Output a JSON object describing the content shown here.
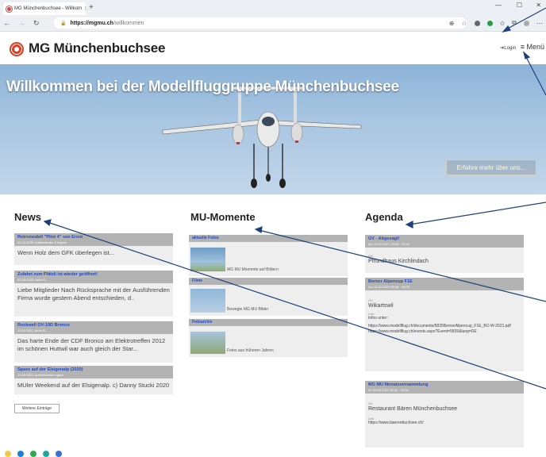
{
  "browser": {
    "tab_title": "MG Münchenbuchsee - Willkom",
    "url_domain": "https://mgmu.ch",
    "url_path": "/willkommen"
  },
  "header": {
    "site_title": "MG Münchenbuchsee",
    "login": "➔Login",
    "menu": "≡ Menü"
  },
  "hero": {
    "title": "Willkommen bei der Modellfluggruppe Münchenbuchsee",
    "button": "Erfahre mehr über uns..."
  },
  "news": {
    "title": "News",
    "items": [
      {
        "title": "Retromodell \"Pilot 4\" von Ernst",
        "meta": "02.10.2020, Administrator 0 Ingens",
        "body": "Wenn Holz dem GFK überlegen ist..."
      },
      {
        "title": "Zufahrt zum Plätzli ist wieder geöffnet!",
        "meta": "22.05.2020, Aeku B.",
        "body": " Liebe Mitglieder Nach Rücksprache mit der Ausführenden Firma wurde gestern Abend entschieden, d.."
      },
      {
        "title": "Rockwell OV-10D Bronco",
        "meta": "11.06.2020, Aeku B.",
        "body": "Das harte Ende der CDF Bronco am Elektrotreffen 2012 im schönen Huttwil war auch gleich der Star..."
      },
      {
        "title": "Spass auf der Elsigenalp (2020)",
        "meta": "11.08.2020, Administrator Ingens",
        "body": "MUler Weekend auf der Elsigenalp. c) Danny Stucki 2020"
      }
    ],
    "more": "Weitere Einträge"
  },
  "mu": {
    "title": "MU-Momente",
    "sections": [
      {
        "head": "aktuelle Fotos",
        "caption": "MG MU Momente auf Bildern"
      },
      {
        "head": "Filme",
        "caption": "Bewegte MG MU Bilder"
      },
      {
        "head": "Fotoarchiv",
        "caption": "Fotos aus früheren Jahren"
      }
    ]
  },
  "agenda": {
    "title": "Agenda",
    "items": [
      {
        "title": "GV - Abgesagt!",
        "meta": "Sa. 29.01.2021 19:00 - 23:59",
        "label": "Ort",
        "place": "Pfrundhaus Kirchlindach"
      },
      {
        "title": "Berner Alpencup F1E",
        "meta": "Sa. 21.02.2021 08:45 - 18:00",
        "label": "Ort",
        "place": "Wikartswil",
        "link_label": "Link",
        "info": "Infos unter:",
        "url1": "https://www.modellflug.ch/documents/5835BernerAlpencup_F1E_BO W-2021.pdf",
        "url2": "https://www.modellflug.ch/events.aspx?Event=5835&lang=DE"
      },
      {
        "title": "MG MU Monatsversammlung",
        "meta": "Di. 09.03.2021 20:30 - 22:00",
        "label": "Ort",
        "place": "Restaurant Bären Münchenbuchsee",
        "link_label": "Link",
        "url1": "https://www.baerenbuchsee.ch/"
      }
    ]
  },
  "colors": {
    "link_blue": "#1f49c6",
    "card_header": "#b3b3b3",
    "card_bg": "#eeeeee",
    "logo_red": "#e03c20"
  }
}
